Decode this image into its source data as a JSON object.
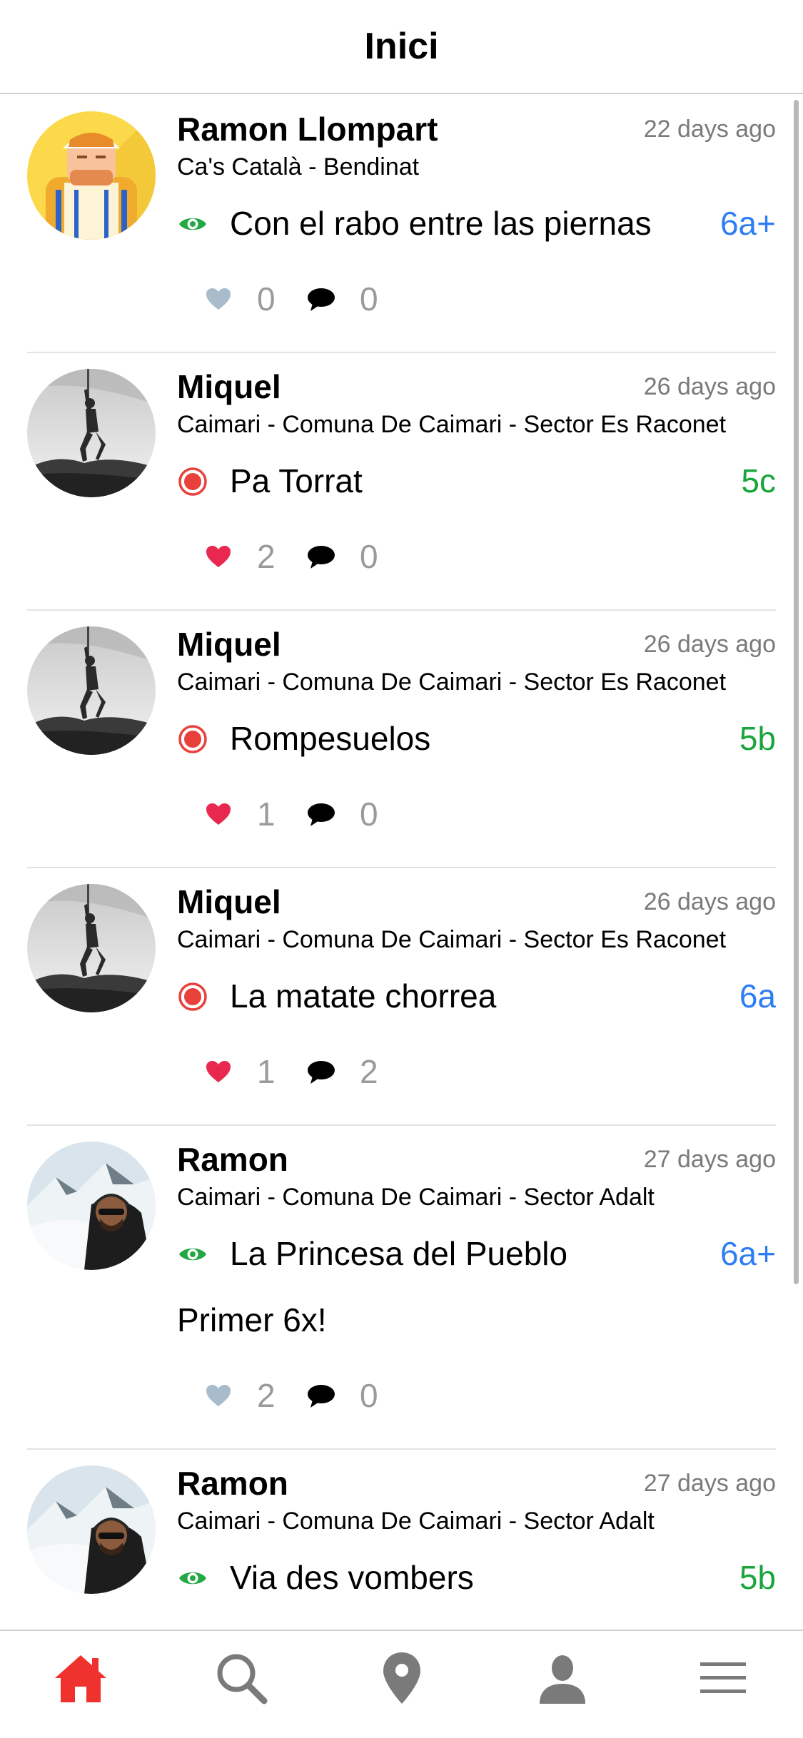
{
  "header": {
    "title": "Inici"
  },
  "colors": {
    "seen_icon": "#22a845",
    "redpoint_icon": "#e8413c",
    "grade_blue": "#2f7df4",
    "grade_green": "#1aa53c",
    "like_active": "#e8284f",
    "like_inactive": "#a8bccc",
    "nav_active": "#f0322e",
    "nav_inactive": "#7a7a7a"
  },
  "posts": [
    {
      "user": "Ramon Llompart",
      "time": "22 days ago",
      "location": "Ca's Català - Bendinat",
      "route_icon": "eye-icon",
      "route": "Con el rabo entre las piernas",
      "grade": "6a+",
      "grade_color": "blue",
      "comment": "",
      "likes": "0",
      "liked": false,
      "comments": "0",
      "avatar": "illustrated-climber-avatar"
    },
    {
      "user": "Miquel",
      "time": "26 days ago",
      "location": "Caimari - Comuna De Caimari - Sector Es Raconet",
      "route_icon": "redpoint-icon",
      "route": "Pa Torrat",
      "grade": "5c",
      "grade_color": "green",
      "comment": "",
      "likes": "2",
      "liked": true,
      "comments": "0",
      "avatar": "bw-climber-photo"
    },
    {
      "user": "Miquel",
      "time": "26 days ago",
      "location": "Caimari - Comuna De Caimari - Sector Es Raconet",
      "route_icon": "redpoint-icon",
      "route": "Rompesuelos",
      "grade": "5b",
      "grade_color": "green",
      "comment": "",
      "likes": "1",
      "liked": true,
      "comments": "0",
      "avatar": "bw-climber-photo"
    },
    {
      "user": "Miquel",
      "time": "26 days ago",
      "location": "Caimari - Comuna De Caimari - Sector Es Raconet",
      "route_icon": "redpoint-icon",
      "route": "La matate chorrea",
      "grade": "6a",
      "grade_color": "blue",
      "comment": "",
      "likes": "1",
      "liked": true,
      "comments": "2",
      "avatar": "bw-climber-photo"
    },
    {
      "user": "Ramon",
      "time": "27 days ago",
      "location": "Caimari - Comuna De Caimari - Sector Adalt",
      "route_icon": "eye-icon",
      "route": "La Princesa del Pueblo",
      "grade": "6a+",
      "grade_color": "blue",
      "comment": "Primer 6x!",
      "likes": "2",
      "liked": false,
      "comments": "0",
      "avatar": "snow-mountain-photo"
    },
    {
      "user": "Ramon",
      "time": "27 days ago",
      "location": "Caimari - Comuna De Caimari - Sector Adalt",
      "route_icon": "eye-icon",
      "route": "Via des vombers",
      "grade": "5b",
      "grade_color": "green",
      "comment": "",
      "likes": "",
      "liked": false,
      "comments": "",
      "avatar": "snow-mountain-photo"
    }
  ],
  "nav": [
    {
      "icon": "home-icon",
      "active": true
    },
    {
      "icon": "search-icon",
      "active": false
    },
    {
      "icon": "map-pin-icon",
      "active": false
    },
    {
      "icon": "profile-icon",
      "active": false
    },
    {
      "icon": "menu-icon",
      "active": false
    }
  ]
}
